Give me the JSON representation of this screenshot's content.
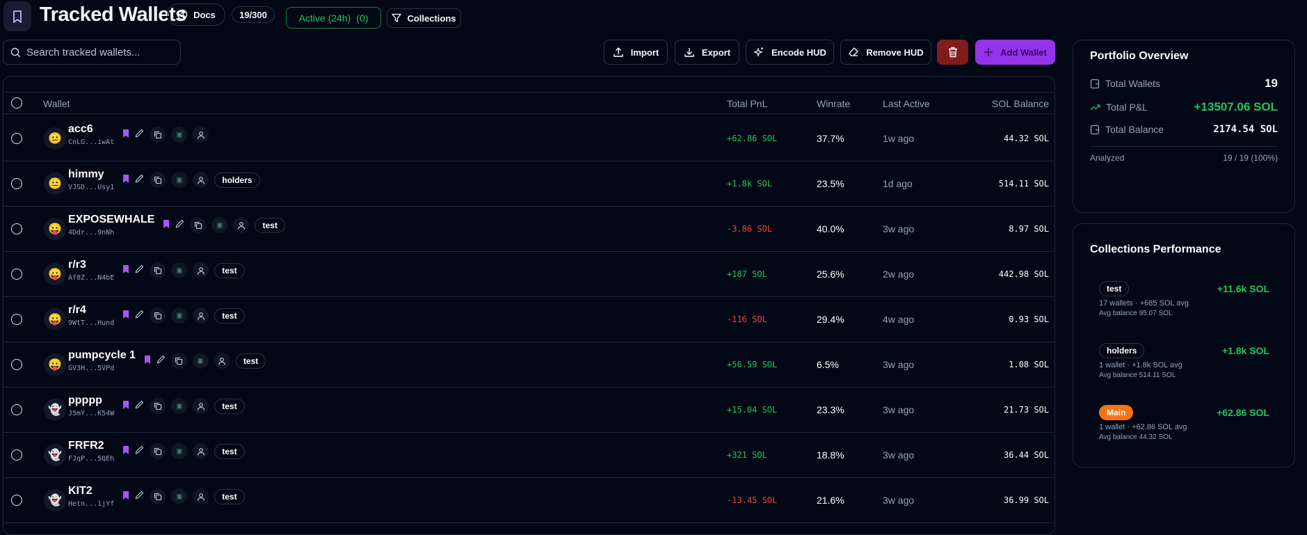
{
  "header": {
    "title": "Tracked Wallets",
    "docs": "Docs",
    "count": "19/300",
    "active_label": "Active (24h)",
    "active_count": "(0)",
    "collections": "Collections"
  },
  "search": {
    "placeholder": "Search tracked wallets..."
  },
  "toolbar": {
    "import": "Import",
    "export": "Export",
    "encode_hud": "Encode HUD",
    "remove_hud": "Remove HUD",
    "add_wallet": "Add Wallet"
  },
  "colors": {
    "accent": "#9333ea",
    "positive": "#22c55e",
    "negative": "#ef4444",
    "delete": "#7f1d1d",
    "main_tag": "#f97316"
  },
  "table": {
    "columns": {
      "wallet": "Wallet",
      "pnl": "Total PnL",
      "winrate": "Winrate",
      "last_active": "Last Active",
      "balance": "SOL Balance"
    },
    "rows": [
      {
        "avatar": "😐",
        "name": "acc6",
        "address": "CnLG...iwAt",
        "tag": "",
        "pnl": "+62.86 SOL",
        "positive": true,
        "winrate": "37.7%",
        "last_active": "1w ago",
        "balance": "44.32 SOL"
      },
      {
        "avatar": "😐",
        "name": "himmy",
        "address": "VJSD...Usy1",
        "tag": "holders",
        "pnl": "+1.8k SOL",
        "positive": true,
        "winrate": "23.5%",
        "last_active": "1d ago",
        "balance": "514.11 SOL"
      },
      {
        "avatar": "😛",
        "name": "EXPOSEWHALE",
        "address": "4Ddr...9nNh",
        "tag": "test",
        "pnl": "-3.86 SOL",
        "positive": false,
        "winrate": "40.0%",
        "last_active": "3w ago",
        "balance": "8.97 SOL"
      },
      {
        "avatar": "😛",
        "name": "r/r3",
        "address": "Af8Z...N4bE",
        "tag": "test",
        "pnl": "+187 SOL",
        "positive": true,
        "winrate": "25.6%",
        "last_active": "2w ago",
        "balance": "442.98 SOL"
      },
      {
        "avatar": "😛",
        "name": "r/r4",
        "address": "9WtT...Hund",
        "tag": "test",
        "pnl": "-116 SOL",
        "positive": false,
        "winrate": "29.4%",
        "last_active": "4w ago",
        "balance": "0.93 SOL"
      },
      {
        "avatar": "😛",
        "name": "pumpcycle 1",
        "address": "GV3H...5VPd",
        "tag": "test",
        "pnl": "+56.59 SOL",
        "positive": true,
        "winrate": "6.5%",
        "last_active": "3w ago",
        "balance": "1.08 SOL"
      },
      {
        "avatar": "👻",
        "name": "ppppp",
        "address": "J5mY...K54W",
        "tag": "test",
        "pnl": "+15.04 SOL",
        "positive": true,
        "winrate": "23.3%",
        "last_active": "3w ago",
        "balance": "21.73 SOL"
      },
      {
        "avatar": "👻",
        "name": "FRFR2",
        "address": "FJqP...5QEh",
        "tag": "test",
        "pnl": "+321 SOL",
        "positive": true,
        "winrate": "18.8%",
        "last_active": "3w ago",
        "balance": "36.44 SOL"
      },
      {
        "avatar": "👻",
        "name": "KIT2",
        "address": "Hetn...1jYf",
        "tag": "test",
        "pnl": "-13.45 SOL",
        "positive": false,
        "winrate": "21.6%",
        "last_active": "3w ago",
        "balance": "36.99 SOL"
      }
    ]
  },
  "portfolio": {
    "title": "Portfolio Overview",
    "total_wallets_label": "Total Wallets",
    "total_wallets": "19",
    "total_pnl_label": "Total P&L",
    "total_pnl": "+13507.06 SOL",
    "total_balance_label": "Total Balance",
    "total_balance": "2174.54 SOL",
    "analyzed_label": "Analyzed",
    "analyzed": "19 / 19 (100%)"
  },
  "collections_perf": {
    "title": "Collections Performance",
    "items": [
      {
        "name": "test",
        "value": "+11.6k SOL",
        "summary": "17 wallets · +685 SOL avg",
        "avg_balance": "Avg balance 95.07 SOL"
      },
      {
        "name": "holders",
        "value": "+1.8k SOL",
        "summary": "1 wallet · +1.8k SOL avg",
        "avg_balance": "Avg balance 514.11 SOL"
      },
      {
        "name": "Main",
        "value": "+62.86 SOL",
        "summary": "1 wallet · +62.86 SOL avg",
        "avg_balance": "Avg balance 44.32 SOL"
      }
    ]
  }
}
